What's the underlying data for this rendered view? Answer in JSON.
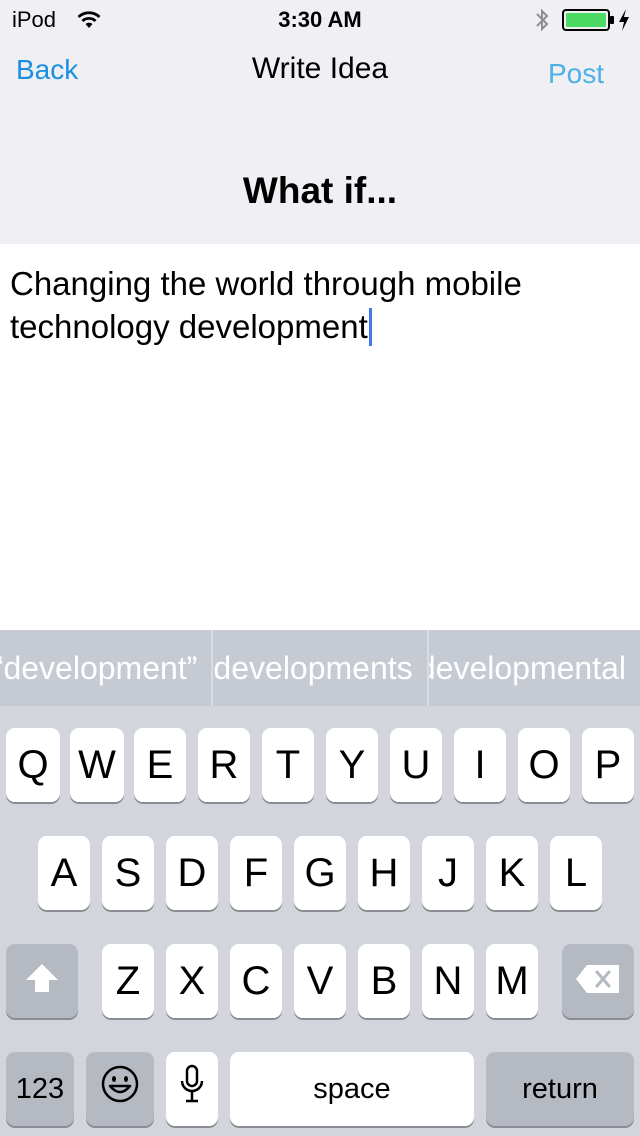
{
  "status_bar": {
    "carrier": "iPod",
    "time": "3:30 AM",
    "battery_color": "#4cd964"
  },
  "nav": {
    "back_label": "Back",
    "title": "Write Idea",
    "post_label": "Post",
    "accent_color": "#1a8fe0"
  },
  "prompt": "What if...",
  "editor": {
    "text": "Changing the world through mobile technology development"
  },
  "suggestions": [
    {
      "label": "“development”"
    },
    {
      "label": "developments"
    },
    {
      "label": "developmental"
    }
  ],
  "keyboard": {
    "row1": [
      "Q",
      "W",
      "E",
      "R",
      "T",
      "Y",
      "U",
      "I",
      "O",
      "P"
    ],
    "row2": [
      "A",
      "S",
      "D",
      "F",
      "G",
      "H",
      "J",
      "K",
      "L"
    ],
    "row3": [
      "Z",
      "X",
      "C",
      "V",
      "B",
      "N",
      "M"
    ],
    "numbers_label": "123",
    "space_label": "space",
    "return_label": "return",
    "shift_icon": "shift-arrow-icon",
    "delete_icon": "backspace-icon",
    "emoji_icon": "emoji-icon",
    "mic_icon": "microphone-icon"
  }
}
